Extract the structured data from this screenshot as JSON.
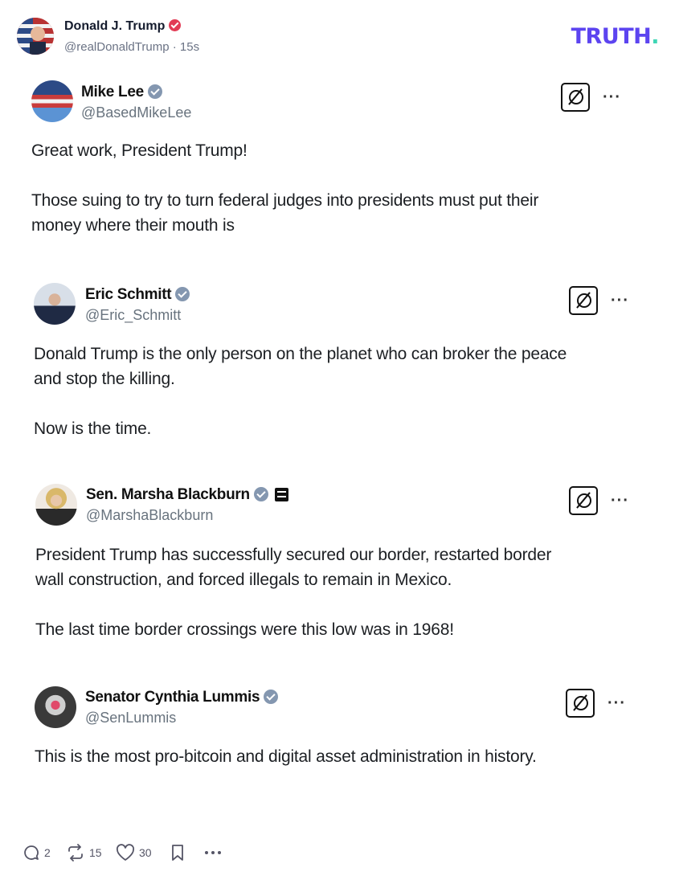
{
  "header": {
    "name": "Donald J. Trump",
    "handle": "@realDonaldTrump",
    "separator": "·",
    "time": "15s",
    "logo": "TRUTH",
    "logo_dot": "."
  },
  "posts": [
    {
      "name": "Mike Lee",
      "handle": "@BasedMikeLee",
      "lines": [
        "Great work, President Trump!",
        "Those suing to try to turn federal judges into presidents must put their",
        "money where their mouth is"
      ]
    },
    {
      "name": "Eric Schmitt",
      "handle": "@Eric_Schmitt",
      "lines": [
        "Donald Trump is the only person on the planet who can broker the peace",
        "and stop the killing.",
        "Now is the time."
      ]
    },
    {
      "name": "Sen. Marsha Blackburn",
      "handle": "@MarshaBlackburn",
      "lines": [
        "President Trump has successfully secured our border, restarted border",
        "wall construction, and forced illegals to remain in Mexico.",
        "The last time border crossings were this low was in 1968!"
      ]
    },
    {
      "name": "Senator Cynthia Lummis",
      "handle": "@SenLummis",
      "lines": [
        "This is the most pro-bitcoin and digital asset administration in history."
      ]
    }
  ],
  "more_label": "···",
  "actions": {
    "replies": "2",
    "retruths": "15",
    "likes": "30"
  },
  "colors": {
    "brand": "#5c44f0",
    "brand_dot": "#3fd6b5",
    "verified_badge": "#e23b55",
    "x_verified": "#8497b0"
  },
  "icons": [
    "reply-icon",
    "retruth-icon",
    "heart-icon",
    "bookmark-icon",
    "more-icon",
    "grok-icon",
    "verified-icon",
    "government-badge-icon"
  ]
}
